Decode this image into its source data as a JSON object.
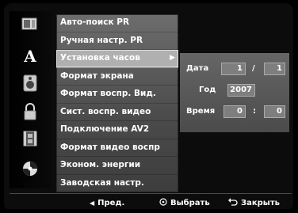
{
  "menu": {
    "items": [
      {
        "label": "Авто-поиск PR"
      },
      {
        "label": "Ручная настр. PR"
      },
      {
        "label": "Установка часов"
      },
      {
        "label": "Формат экрана"
      },
      {
        "label": "Формат воспр. Вид."
      },
      {
        "label": "Сист. воспр. видео"
      },
      {
        "label": "Подключение AV2"
      },
      {
        "label": "Формат видео воспр"
      },
      {
        "label": "Эконом. энергии"
      },
      {
        "label": "Заводская настр."
      }
    ],
    "selected_index": 2,
    "arrow": "▶"
  },
  "clock": {
    "date_label": "Дата",
    "date_day": "1",
    "date_sep": "/",
    "date_month": "1",
    "year_label": "Год",
    "year_value": "2007",
    "time_label": "Время",
    "time_hour": "0",
    "time_sep": ":",
    "time_min": "0"
  },
  "footer": {
    "prev": "Пред.",
    "select": "Выбрать",
    "close": "Закрыть"
  },
  "colors": {
    "menu_bg": "#5a5a5a",
    "selected_bg": "#b0b0b0"
  }
}
